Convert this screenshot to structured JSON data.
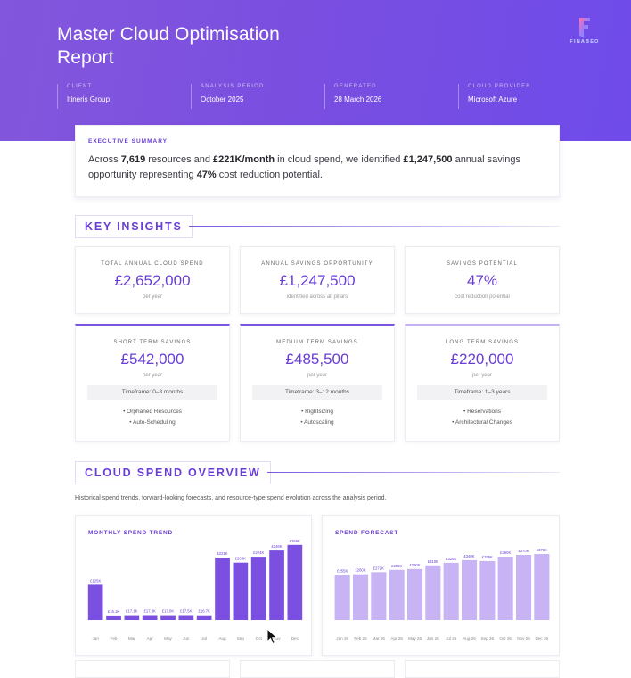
{
  "report": {
    "title_line1": "Master Cloud Optimisation",
    "title_line2": "Report",
    "brand_name": "FINABEO"
  },
  "meta": [
    {
      "label": "CLIENT",
      "value": "Itineris Group"
    },
    {
      "label": "ANALYSIS PERIOD",
      "value": "October 2025"
    },
    {
      "label": "GENERATED",
      "value": "28 March 2026"
    },
    {
      "label": "CLOUD PROVIDER",
      "value": "Microsoft Azure"
    }
  ],
  "summary": {
    "label": "EXECUTIVE SUMMARY",
    "p1": "Across ",
    "resources": "7,619",
    "p2": " resources and ",
    "monthly": "£221K/month",
    "p3": " in cloud spend, we identified ",
    "annual": "£1,247,500",
    "p4": " annual savings opportunity representing ",
    "pct": "47%",
    "p5": " cost reduction potential."
  },
  "key_insights": {
    "heading": "KEY INSIGHTS",
    "top": [
      {
        "label": "TOTAL ANNUAL CLOUD SPEND",
        "value": "£2,652,000",
        "sub": "per year"
      },
      {
        "label": "ANNUAL SAVINGS OPPORTUNITY",
        "value": "£1,247,500",
        "sub": "identified across all pillars"
      },
      {
        "label": "SAVINGS POTENTIAL",
        "value": "47%",
        "sub": "cost reduction potential"
      }
    ],
    "terms": [
      {
        "label": "SHORT TERM SAVINGS",
        "value": "£542,000",
        "sub": "per year",
        "timeframe": "Timeframe: 0–3 months",
        "items": [
          "• Orphaned Resources",
          "• Auto-Scheduling"
        ]
      },
      {
        "label": "MEDIUM TERM SAVINGS",
        "value": "£485,500",
        "sub": "per year",
        "timeframe": "Timeframe: 3–12 months",
        "items": [
          "• Rightsizing",
          "• Autoscaling"
        ]
      },
      {
        "label": "LONG TERM SAVINGS",
        "value": "£220,000",
        "sub": "per year",
        "timeframe": "Timeframe: 1–3 years",
        "items": [
          "• Reservations",
          "• Architectural Changes"
        ]
      }
    ]
  },
  "overview": {
    "heading": "CLOUD SPEND OVERVIEW",
    "description": "Historical spend trends, forward-looking forecasts, and resource-type spend evolution across the analysis period."
  },
  "colors": {
    "accent": "#6a3ed6",
    "bar_dark": "#7b4fe0",
    "bar_light": "#c8b4f4"
  },
  "chart_data": [
    {
      "type": "bar",
      "title": "MONTHLY SPEND TREND",
      "categories": [
        "Jan",
        "Feb",
        "Mar",
        "Apr",
        "May",
        "Jun",
        "Jul",
        "Aug",
        "Sep",
        "Oct",
        "Nov",
        "Dec"
      ],
      "values": [
        125,
        16.1,
        17.1,
        17.3,
        17.0,
        17.5,
        16.7,
        221,
        203,
        224,
        246,
        266
      ],
      "labels": [
        "£125K",
        "£16.1K",
        "£17.1K",
        "£17.3K",
        "£17.0K",
        "£17.5K",
        "£16.7K",
        "£221K",
        "£203K",
        "£224K",
        "£246K",
        "£266K"
      ],
      "ylim": [
        0,
        300
      ]
    },
    {
      "type": "bar",
      "title": "SPEND FORECAST",
      "categories": [
        "Jan 26",
        "Feb 26",
        "Mar 26",
        "Apr 26",
        "May 26",
        "Jun 26",
        "Jul 26",
        "Aug 26",
        "Sep 26",
        "Oct 26",
        "Nov 26",
        "Dec 26"
      ],
      "values": [
        255,
        260,
        272,
        285,
        290,
        310,
        325,
        340,
        335,
        360,
        370,
        375
      ],
      "labels": [
        "£255K",
        "£260K",
        "£272K",
        "£285K",
        "£290K",
        "£310K",
        "£325K",
        "£340K",
        "£335K",
        "£360K",
        "£370K",
        "£375K"
      ],
      "ylim": [
        0,
        375
      ]
    }
  ]
}
